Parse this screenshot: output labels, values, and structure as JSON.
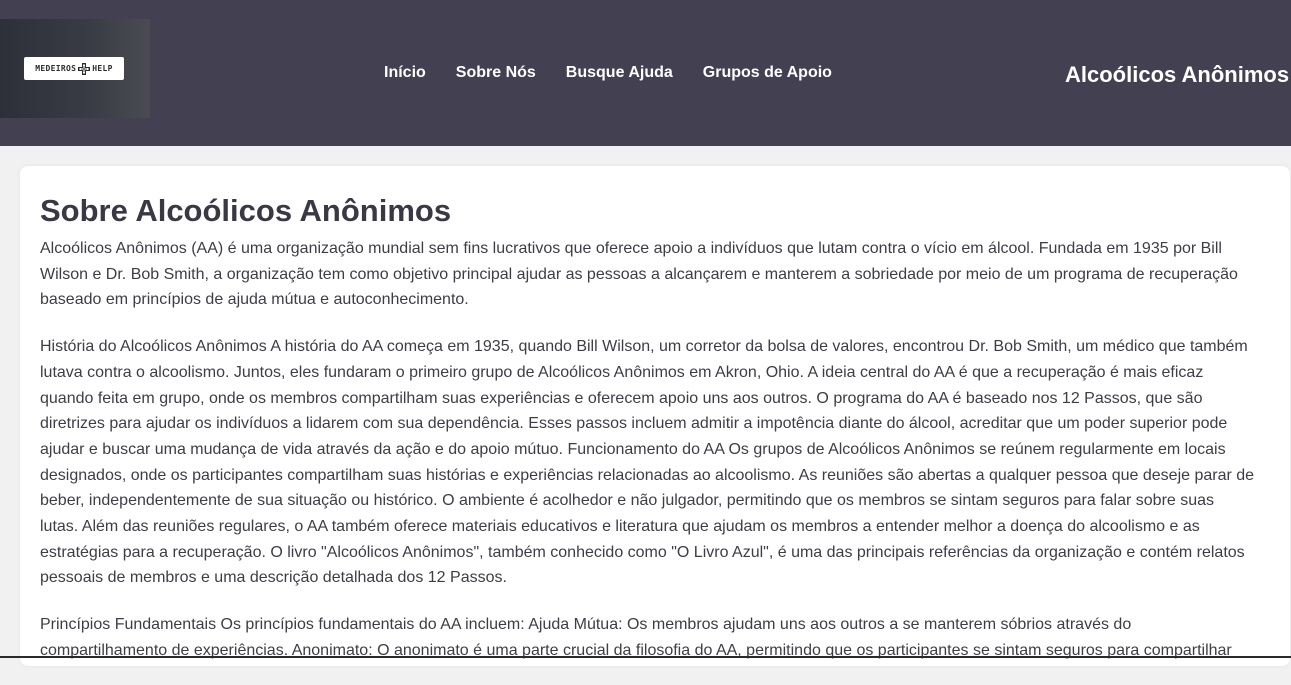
{
  "header": {
    "logo": {
      "text_left": "MEDEIROS",
      "text_right": "HELP",
      "icon": "medical-cross-icon"
    },
    "nav": [
      {
        "label": "Início"
      },
      {
        "label": "Sobre Nós"
      },
      {
        "label": "Busque Ajuda"
      },
      {
        "label": "Grupos de Apoio"
      }
    ],
    "site_title": "Alcoólicos Anônimos"
  },
  "main": {
    "title": "Sobre Alcoólicos Anônimos",
    "paragraphs": [
      "Alcoólicos Anônimos (AA) é uma organização mundial sem fins lucrativos que oferece apoio a indivíduos que lutam contra o vício em álcool. Fundada em 1935 por Bill Wilson e Dr. Bob Smith, a organização tem como objetivo principal ajudar as pessoas a alcançarem e manterem a sobriedade por meio de um programa de recuperação baseado em princípios de ajuda mútua e autoconhecimento.",
      "História do Alcoólicos Anônimos A história do AA começa em 1935, quando Bill Wilson, um corretor da bolsa de valores, encontrou Dr. Bob Smith, um médico que também lutava contra o alcoolismo. Juntos, eles fundaram o primeiro grupo de Alcoólicos Anônimos em Akron, Ohio. A ideia central do AA é que a recuperação é mais eficaz quando feita em grupo, onde os membros compartilham suas experiências e oferecem apoio uns aos outros. O programa do AA é baseado nos 12 Passos, que são diretrizes para ajudar os indivíduos a lidarem com sua dependência. Esses passos incluem admitir a impotência diante do álcool, acreditar que um poder superior pode ajudar e buscar uma mudança de vida através da ação e do apoio mútuo. Funcionamento do AA Os grupos de Alcoólicos Anônimos se reúnem regularmente em locais designados, onde os participantes compartilham suas histórias e experiências relacionadas ao alcoolismo. As reuniões são abertas a qualquer pessoa que deseje parar de beber, independentemente de sua situação ou histórico. O ambiente é acolhedor e não julgador, permitindo que os membros se sintam seguros para falar sobre suas lutas. Além das reuniões regulares, o AA também oferece materiais educativos e literatura que ajudam os membros a entender melhor a doença do alcoolismo e as estratégias para a recuperação. O livro \"Alcoólicos Anônimos\", também conhecido como \"O Livro Azul\", é uma das principais referências da organização e contém relatos pessoais de membros e uma descrição detalhada dos 12 Passos.",
      "Princípios Fundamentais Os princípios fundamentais do AA incluem: Ajuda Mútua: Os membros ajudam uns aos outros a se manterem sóbrios através do compartilhamento de experiências. Anonimato: O anonimato é uma parte crucial da filosofia do AA, permitindo que os participantes se sintam seguros para compartilhar"
    ]
  },
  "colors": {
    "header_bg": "#434052",
    "page_bg": "#f1f1f2",
    "card_bg": "#ffffff",
    "title_text": "#3a3845",
    "body_text": "#3d3d48"
  }
}
